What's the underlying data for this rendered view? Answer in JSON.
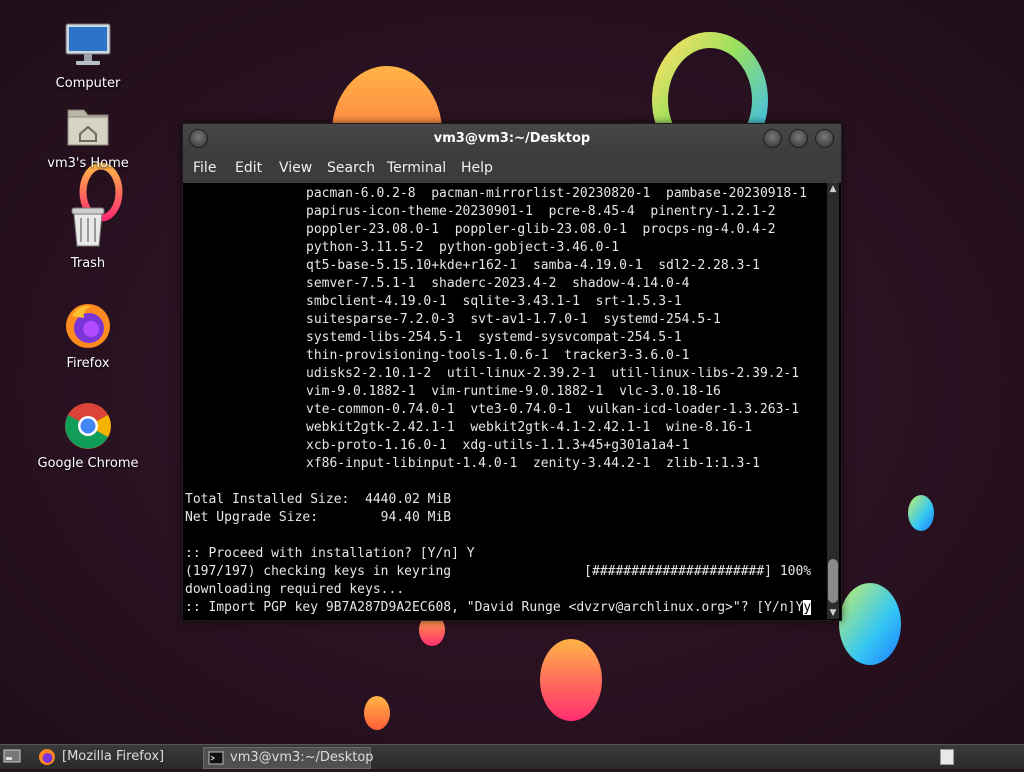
{
  "desktop": {
    "icons": [
      {
        "label": "Computer",
        "icon": "computer-monitor-icon"
      },
      {
        "label": "vm3's Home",
        "icon": "home-folder-icon"
      },
      {
        "label": "Trash",
        "icon": "trash-can-icon"
      },
      {
        "label": "Firefox",
        "icon": "firefox-icon"
      },
      {
        "label": "Google Chrome",
        "icon": "chrome-icon"
      }
    ],
    "wallpaper_colors": [
      "#2a1320",
      "#ff6b35",
      "#ff2d6f",
      "#3ec6ff",
      "#b6e34a"
    ]
  },
  "terminal": {
    "title": "vm3@vm3:~/Desktop",
    "menu": [
      "File",
      "Edit",
      "View",
      "Search",
      "Terminal",
      "Help"
    ],
    "packages": [
      "pacman-6.0.2-8  pacman-mirrorlist-20230820-1  pambase-20230918-1",
      "papirus-icon-theme-20230901-1  pcre-8.45-4  pinentry-1.2.1-2",
      "poppler-23.08.0-1  poppler-glib-23.08.0-1  procps-ng-4.0.4-2",
      "python-3.11.5-2  python-gobject-3.46.0-1",
      "qt5-base-5.15.10+kde+r162-1  samba-4.19.0-1  sdl2-2.28.3-1",
      "semver-7.5.1-1  shaderc-2023.4-2  shadow-4.14.0-4",
      "smbclient-4.19.0-1  sqlite-3.43.1-1  srt-1.5.3-1",
      "suitesparse-7.2.0-3  svt-av1-1.7.0-1  systemd-254.5-1",
      "systemd-libs-254.5-1  systemd-sysvcompat-254.5-1",
      "thin-provisioning-tools-1.0.6-1  tracker3-3.6.0-1",
      "udisks2-2.10.1-2  util-linux-2.39.2-1  util-linux-libs-2.39.2-1",
      "vim-9.0.1882-1  vim-runtime-9.0.1882-1  vlc-3.0.18-16",
      "vte-common-0.74.0-1  vte3-0.74.0-1  vulkan-icd-loader-1.3.263-1",
      "webkit2gtk-2.42.1-1  webkit2gtk-4.1-2.42.1-1  wine-8.16-1",
      "xcb-proto-1.16.0-1  xdg-utils-1.1.3+45+g301a1a4-1",
      "xf86-input-libinput-1.4.0-1  zenity-3.44.2-1  zlib-1:1.3-1"
    ],
    "total_installed_size": "Total Installed Size:  4440.02 MiB",
    "net_upgrade_size": "Net Upgrade Size:        94.40 MiB",
    "proceed_prompt": ":: Proceed with installation? [Y/n] Y",
    "checking_keys": "(197/197) checking keys in keyring                 [######################] 100%",
    "downloading_keys": "downloading required keys...",
    "import_prompt": ":: Import PGP key 9B7A287D9A2EC608, \"David Runge <dvzrv@archlinux.org>\"? [Y/n]",
    "typed_answer": "Y",
    "cursor_char": "y"
  },
  "taskbar": {
    "items": [
      {
        "label": "[Mozilla Firefox]",
        "icon": "firefox-icon"
      },
      {
        "label": "vm3@vm3:~/Desktop",
        "icon": "terminal-icon"
      }
    ]
  }
}
